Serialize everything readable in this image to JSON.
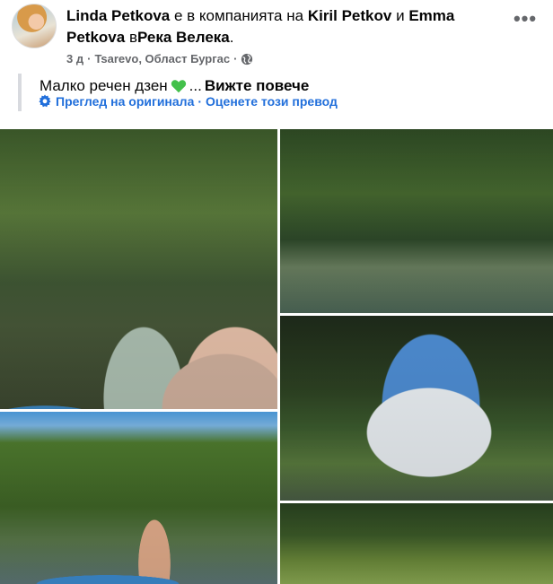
{
  "post": {
    "author": "Linda Petkova",
    "with_text": "е в компанията на",
    "tag1": "Kiril Petkov",
    "and_text": "и",
    "tag2": "Emma Petkova",
    "in_text": "в",
    "place": "Река Велека",
    "period": ".",
    "time": "3 д",
    "dot": "·",
    "location": "Tsarevo, Област Бургас",
    "dot2": "·",
    "more_icon": "ellipsis-icon",
    "privacy_icon": "globe-icon"
  },
  "caption": {
    "text": "Малко речен дзен",
    "emoji": "green-heart-icon",
    "ellipsis": "...",
    "see_more": "Вижте повече"
  },
  "translation": {
    "icon": "gear-icon",
    "view_original": "Преглед на оригинала",
    "separator": "·",
    "rate": "Оценете този превод"
  },
  "colors": {
    "link_blue": "#216fdb",
    "muted": "#65676b",
    "heart_green": "#43c04b"
  }
}
